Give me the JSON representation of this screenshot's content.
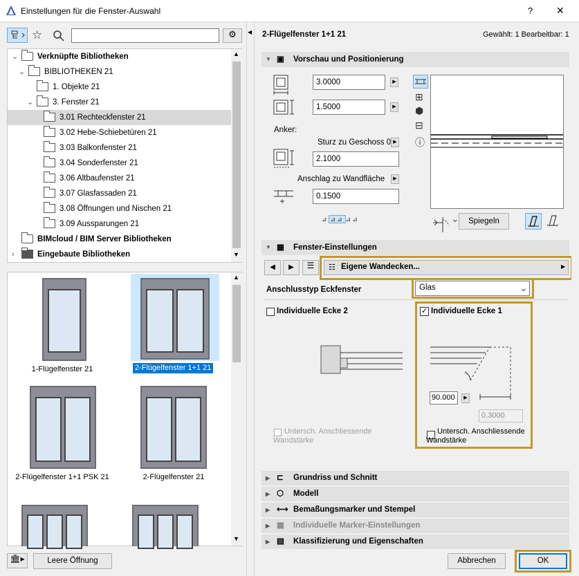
{
  "window": {
    "title": "Einstellungen für die Fenster-Auswahl",
    "help": "?",
    "close": "✕"
  },
  "left": {
    "search_placeholder": "",
    "tree": [
      {
        "label": "Verknüpfte Bibliotheken",
        "level": 0,
        "expand": "⌄",
        "bold": true,
        "icon": "library-icon"
      },
      {
        "label": "BIBLIOTHEKEN 21",
        "level": 1,
        "expand": "⌄",
        "bold": false,
        "icon": "folder-icon"
      },
      {
        "label": "1. Objekte 21",
        "level": 2,
        "expand": "",
        "bold": false,
        "icon": "folder-icon"
      },
      {
        "label": "3. Fenster 21",
        "level": 2,
        "expand": "⌄",
        "bold": false,
        "icon": "folder-icon"
      },
      {
        "label": "3.01 Rechteckfenster 21",
        "level": 3,
        "expand": "",
        "bold": false,
        "icon": "folder-icon",
        "selected": true
      },
      {
        "label": "3.02 Hebe-Schiebetüren 21",
        "level": 3,
        "expand": "",
        "bold": false,
        "icon": "folder-icon"
      },
      {
        "label": "3.03 Balkonfenster 21",
        "level": 3,
        "expand": "",
        "bold": false,
        "icon": "folder-icon"
      },
      {
        "label": "3.04 Sonderfenster 21",
        "level": 3,
        "expand": "",
        "bold": false,
        "icon": "folder-icon"
      },
      {
        "label": "3.06 Altbaufenster 21",
        "level": 3,
        "expand": "",
        "bold": false,
        "icon": "folder-icon"
      },
      {
        "label": "3.07 Glasfassaden 21",
        "level": 3,
        "expand": "",
        "bold": false,
        "icon": "folder-icon"
      },
      {
        "label": "3.08 Öffnungen und Nischen 21",
        "level": 3,
        "expand": "",
        "bold": false,
        "icon": "folder-icon"
      },
      {
        "label": "3.09 Aussparungen 21",
        "level": 3,
        "expand": "",
        "bold": false,
        "icon": "folder-icon"
      },
      {
        "label": "BIMcloud / BIM Server Bibliotheken",
        "level": 0,
        "expand": "",
        "bold": true,
        "icon": "cloud-library-icon"
      },
      {
        "label": "Eingebaute Bibliotheken",
        "level": 0,
        "expand": "›",
        "bold": true,
        "icon": "folder-dark-icon"
      }
    ],
    "objects": [
      {
        "label": "1-Flügelfenster 21",
        "selected": false
      },
      {
        "label": "2-Flügelfenster 1+1 21",
        "selected": true
      },
      {
        "label": "2-Flügelfenster 1+1 PSK 21",
        "selected": false
      },
      {
        "label": "2-Flügelfenster 21",
        "selected": false
      }
    ],
    "empty_opening_button": "Leere Öffnung"
  },
  "right": {
    "object_name": "2-Flügelfenster 1+1 21",
    "selection_info": "Gewählt: 1 Bearbeitbar: 1",
    "sections": {
      "preview": "Vorschau und Positionierung",
      "window_settings": "Fenster-Einstellungen",
      "floorplan": "Grundriss und Schnitt",
      "model": "Modell",
      "dimension_markers": "Bemaßungsmarker und Stempel",
      "marker_settings": "Individuelle Marker-Einstellungen",
      "classification": "Klassifizierung und Eigenschaften"
    },
    "width": "3.0000",
    "height": "1.5000",
    "anchor_label": "Anker:",
    "sill_ref": "Sturz zu Geschoss 0",
    "sill_value": "2.1000",
    "reveal_ref": "Anschlag zu Wandfläche",
    "reveal_value": "0.1500",
    "mirror_button": "Spiegeln",
    "page_dropdown": "Eigene Wandecken...",
    "corner_type_label": "Anschlusstyp Eckfenster",
    "corner_type_value": "Glas",
    "corner2_label": "Individuelle Ecke 2",
    "corner2_checked": false,
    "corner1_label": "Individuelle Ecke 1",
    "corner1_checked": true,
    "angle_value": "90.000",
    "thickness_value": "0.3000",
    "diff_thickness_left": "Untersch. Anschliessende Wandstärke",
    "diff_thickness_right": "Untersch. Anschliessende Wandstärke",
    "cancel_button": "Abbrechen",
    "ok_button": "OK"
  },
  "colors": {
    "highlight": "#c09a2c",
    "selection": "#cce8ff",
    "ok_border": "#0078d7"
  }
}
